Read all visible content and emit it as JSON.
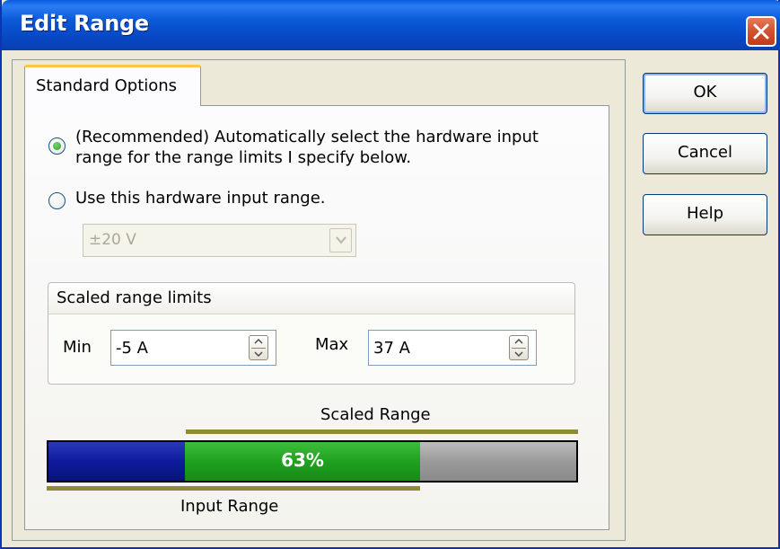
{
  "dialog": {
    "title": "Edit Range"
  },
  "tabs": [
    {
      "label": "Standard Options",
      "selected": true
    }
  ],
  "options": {
    "auto_range": {
      "selected": true,
      "line1": "(Recommended) Automatically select the hardware input",
      "line2": "range for the range limits I specify below."
    },
    "manual_range": {
      "selected": false,
      "label": "Use this hardware input range."
    },
    "hardware_range": {
      "value": "±20 V",
      "enabled": false
    }
  },
  "scaled_limits": {
    "title": "Scaled range limits",
    "min_label": "Min",
    "min_value": "-5 A",
    "max_label": "Max",
    "max_value": "37 A"
  },
  "range_display": {
    "scaled_label": "Scaled Range",
    "input_label": "Input Range",
    "percent_text": "63%",
    "coverage_percent": 63
  },
  "buttons": {
    "ok": "OK",
    "cancel": "Cancel",
    "help": "Help"
  },
  "colors": {
    "title_bar": "#0a5ad8",
    "below_range": "#0e1b9c",
    "used_range": "#1fa21f",
    "unused_range": "#9a9a9a"
  }
}
